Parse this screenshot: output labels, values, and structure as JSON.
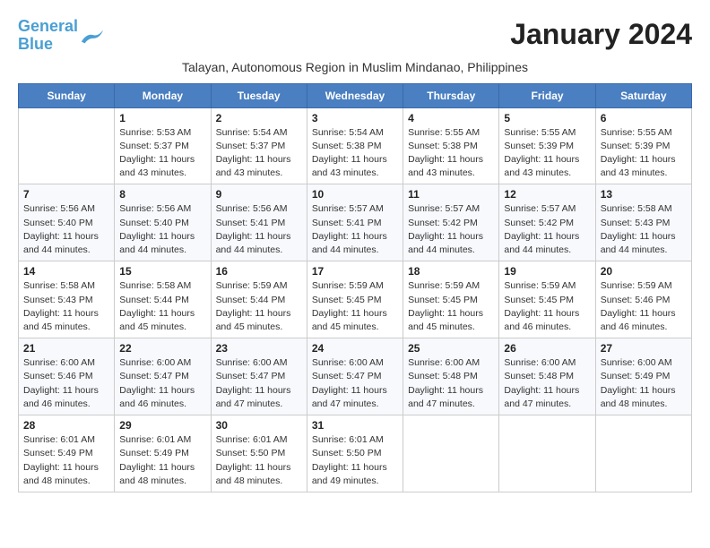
{
  "header": {
    "logo_line1": "General",
    "logo_line2": "Blue",
    "title": "January 2024",
    "subtitle": "Talayan, Autonomous Region in Muslim Mindanao, Philippines"
  },
  "days_of_week": [
    "Sunday",
    "Monday",
    "Tuesday",
    "Wednesday",
    "Thursday",
    "Friday",
    "Saturday"
  ],
  "weeks": [
    [
      {
        "day": "",
        "info": ""
      },
      {
        "day": "1",
        "info": "Sunrise: 5:53 AM\nSunset: 5:37 PM\nDaylight: 11 hours\nand 43 minutes."
      },
      {
        "day": "2",
        "info": "Sunrise: 5:54 AM\nSunset: 5:37 PM\nDaylight: 11 hours\nand 43 minutes."
      },
      {
        "day": "3",
        "info": "Sunrise: 5:54 AM\nSunset: 5:38 PM\nDaylight: 11 hours\nand 43 minutes."
      },
      {
        "day": "4",
        "info": "Sunrise: 5:55 AM\nSunset: 5:38 PM\nDaylight: 11 hours\nand 43 minutes."
      },
      {
        "day": "5",
        "info": "Sunrise: 5:55 AM\nSunset: 5:39 PM\nDaylight: 11 hours\nand 43 minutes."
      },
      {
        "day": "6",
        "info": "Sunrise: 5:55 AM\nSunset: 5:39 PM\nDaylight: 11 hours\nand 43 minutes."
      }
    ],
    [
      {
        "day": "7",
        "info": "Sunrise: 5:56 AM\nSunset: 5:40 PM\nDaylight: 11 hours\nand 44 minutes."
      },
      {
        "day": "8",
        "info": "Sunrise: 5:56 AM\nSunset: 5:40 PM\nDaylight: 11 hours\nand 44 minutes."
      },
      {
        "day": "9",
        "info": "Sunrise: 5:56 AM\nSunset: 5:41 PM\nDaylight: 11 hours\nand 44 minutes."
      },
      {
        "day": "10",
        "info": "Sunrise: 5:57 AM\nSunset: 5:41 PM\nDaylight: 11 hours\nand 44 minutes."
      },
      {
        "day": "11",
        "info": "Sunrise: 5:57 AM\nSunset: 5:42 PM\nDaylight: 11 hours\nand 44 minutes."
      },
      {
        "day": "12",
        "info": "Sunrise: 5:57 AM\nSunset: 5:42 PM\nDaylight: 11 hours\nand 44 minutes."
      },
      {
        "day": "13",
        "info": "Sunrise: 5:58 AM\nSunset: 5:43 PM\nDaylight: 11 hours\nand 44 minutes."
      }
    ],
    [
      {
        "day": "14",
        "info": "Sunrise: 5:58 AM\nSunset: 5:43 PM\nDaylight: 11 hours\nand 45 minutes."
      },
      {
        "day": "15",
        "info": "Sunrise: 5:58 AM\nSunset: 5:44 PM\nDaylight: 11 hours\nand 45 minutes."
      },
      {
        "day": "16",
        "info": "Sunrise: 5:59 AM\nSunset: 5:44 PM\nDaylight: 11 hours\nand 45 minutes."
      },
      {
        "day": "17",
        "info": "Sunrise: 5:59 AM\nSunset: 5:45 PM\nDaylight: 11 hours\nand 45 minutes."
      },
      {
        "day": "18",
        "info": "Sunrise: 5:59 AM\nSunset: 5:45 PM\nDaylight: 11 hours\nand 45 minutes."
      },
      {
        "day": "19",
        "info": "Sunrise: 5:59 AM\nSunset: 5:45 PM\nDaylight: 11 hours\nand 46 minutes."
      },
      {
        "day": "20",
        "info": "Sunrise: 5:59 AM\nSunset: 5:46 PM\nDaylight: 11 hours\nand 46 minutes."
      }
    ],
    [
      {
        "day": "21",
        "info": "Sunrise: 6:00 AM\nSunset: 5:46 PM\nDaylight: 11 hours\nand 46 minutes."
      },
      {
        "day": "22",
        "info": "Sunrise: 6:00 AM\nSunset: 5:47 PM\nDaylight: 11 hours\nand 46 minutes."
      },
      {
        "day": "23",
        "info": "Sunrise: 6:00 AM\nSunset: 5:47 PM\nDaylight: 11 hours\nand 47 minutes."
      },
      {
        "day": "24",
        "info": "Sunrise: 6:00 AM\nSunset: 5:47 PM\nDaylight: 11 hours\nand 47 minutes."
      },
      {
        "day": "25",
        "info": "Sunrise: 6:00 AM\nSunset: 5:48 PM\nDaylight: 11 hours\nand 47 minutes."
      },
      {
        "day": "26",
        "info": "Sunrise: 6:00 AM\nSunset: 5:48 PM\nDaylight: 11 hours\nand 47 minutes."
      },
      {
        "day": "27",
        "info": "Sunrise: 6:00 AM\nSunset: 5:49 PM\nDaylight: 11 hours\nand 48 minutes."
      }
    ],
    [
      {
        "day": "28",
        "info": "Sunrise: 6:01 AM\nSunset: 5:49 PM\nDaylight: 11 hours\nand 48 minutes."
      },
      {
        "day": "29",
        "info": "Sunrise: 6:01 AM\nSunset: 5:49 PM\nDaylight: 11 hours\nand 48 minutes."
      },
      {
        "day": "30",
        "info": "Sunrise: 6:01 AM\nSunset: 5:50 PM\nDaylight: 11 hours\nand 48 minutes."
      },
      {
        "day": "31",
        "info": "Sunrise: 6:01 AM\nSunset: 5:50 PM\nDaylight: 11 hours\nand 49 minutes."
      },
      {
        "day": "",
        "info": ""
      },
      {
        "day": "",
        "info": ""
      },
      {
        "day": "",
        "info": ""
      }
    ]
  ]
}
